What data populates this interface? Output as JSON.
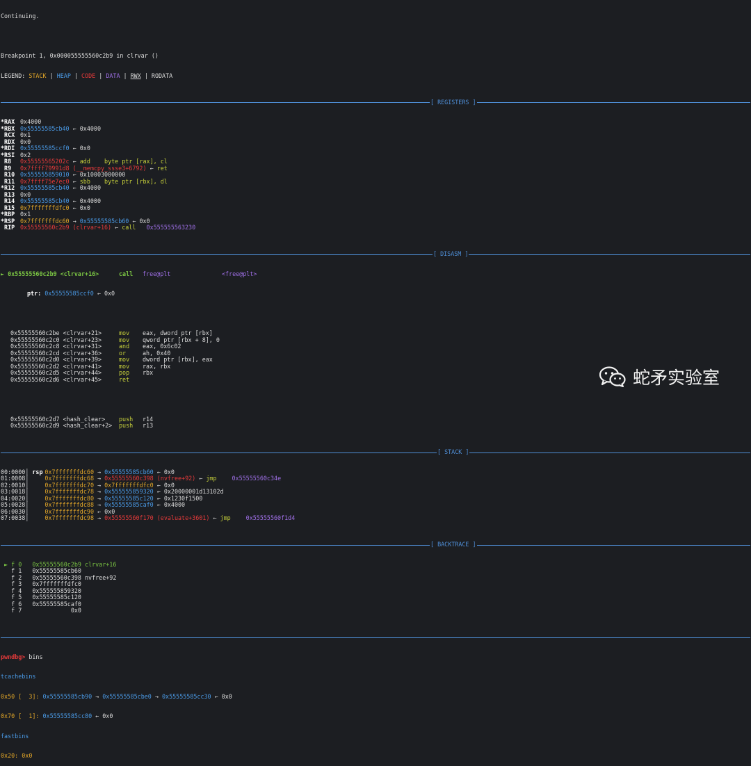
{
  "header": {
    "continuing": "Continuing.",
    "breakpoint": "Breakpoint 1, 0x000055555560c2b9 in clrvar ()",
    "legend_prefix": "LEGEND: ",
    "legend_stack": "STACK",
    "legend_heap": "HEAP",
    "legend_code": "CODE",
    "legend_data": "DATA",
    "legend_rwx": "RWX",
    "legend_rodata": "RODATA",
    "sep": " | "
  },
  "sections": {
    "registers": "[ REGISTERS ]",
    "disasm": "[ DISASM ]",
    "stack": "[ STACK ]",
    "backtrace": "[ BACKTRACE ]"
  },
  "registers": [
    {
      "name": "*RAX",
      "val": "0x4000"
    },
    {
      "name": "*RBX",
      "val": "0x55555585cb40",
      "arrow": " ← ",
      "ref": "0x4000"
    },
    {
      "name": " RCX",
      "val": "0x1"
    },
    {
      "name": " RDX",
      "val": "0x0"
    },
    {
      "name": "*RDI",
      "val": "0x55555585ccf0",
      "arrow": " ← ",
      "ref": "0x0"
    },
    {
      "name": "*RSI",
      "val": "0x2"
    },
    {
      "name": " R8",
      "val": "0x55555565202c",
      "arrow": " ← ",
      "ins": "add    byte ptr [rax], cl"
    },
    {
      "name": " R9",
      "val": "0x7ffff79991d8 (__memcpy_ssse3+6792)",
      "arrow": " ← ",
      "ins": "ret"
    },
    {
      "name": " R10",
      "val": "0x555555859010",
      "arrow": " ← ",
      "ref": "0x10003000000"
    },
    {
      "name": " R11",
      "val": "0x7ffff75e7ec0",
      "arrow": " ← ",
      "ins": "sbb    byte ptr [rbx], dl"
    },
    {
      "name": "*R12",
      "val": "0x55555585cb40",
      "arrow": " ← ",
      "ref": "0x4000"
    },
    {
      "name": " R13",
      "val": "0x0"
    },
    {
      "name": " R14",
      "val": "0x55555585cb40",
      "arrow": " ← ",
      "ref": "0x4000"
    },
    {
      "name": " R15",
      "val": "0x7fffffffdfc0",
      "arrow": " ← ",
      "ref": "0x0"
    },
    {
      "name": "*RBP",
      "val": "0x1"
    },
    {
      "name": "*RSP",
      "val": "0x7fffffffdc60",
      "arrow": " → ",
      "val2": "0x55555585cb60",
      "arrow2": " ← ",
      "ref": "0x0"
    },
    {
      "name": " RIP",
      "val": "0x55555560c2b9 (clrvar+16)",
      "arrow": " ← ",
      "ins": "call   ",
      "ins2": "0x555555563230"
    }
  ],
  "disasm": {
    "current_marker": "►",
    "current_addr": "0x55555560c2b9 <clrvar+16>",
    "current_mn": "call",
    "current_op": "free@plt",
    "current_target": "<free@plt>",
    "ptr_label": "ptr: ",
    "ptr_val": "0x55555585ccf0",
    "ptr_ref": " ← 0x0",
    "lines": [
      {
        "addr": "0x55555560c2be <clrvar+21>",
        "mn": "mov",
        "op": "eax, dword ptr [rbx]"
      },
      {
        "addr": "0x55555560c2c0 <clrvar+23>",
        "mn": "mov",
        "op": "qword ptr [rbx + 8], 0"
      },
      {
        "addr": "0x55555560c2c8 <clrvar+31>",
        "mn": "and",
        "op": "eax, 0x6c02"
      },
      {
        "addr": "0x55555560c2cd <clrvar+36>",
        "mn": "or",
        "op": "ah, 0x40"
      },
      {
        "addr": "0x55555560c2d0 <clrvar+39>",
        "mn": "mov",
        "op": "dword ptr [rbx], eax"
      },
      {
        "addr": "0x55555560c2d2 <clrvar+41>",
        "mn": "mov",
        "op": "rax, rbx"
      },
      {
        "addr": "0x55555560c2d5 <clrvar+44>",
        "mn": "pop",
        "op": "rbx"
      },
      {
        "addr": "0x55555560c2d6 <clrvar+45>",
        "mn": "ret",
        "op": ""
      }
    ],
    "lines2": [
      {
        "addr": "0x55555560c2d7 <hash_clear>",
        "mn": "push",
        "op": "r14"
      },
      {
        "addr": "0x55555560c2d9 <hash_clear+2>",
        "mn": "push",
        "op": "r13"
      }
    ]
  },
  "stack": [
    {
      "idx": "00:0000",
      "tag": "rsp",
      "a": "0x7fffffffdc60",
      "b": "0x55555585cb60",
      "bc": "bl",
      "rest": " ← 0x0"
    },
    {
      "idx": "01:0008",
      "tag": "",
      "a": "0x7fffffffdc68",
      "b": "0x55555560c398 (nvfree+92)",
      "bc": "rd",
      "rest": " ← ",
      "mn": "jmp",
      "tgt": "0x55555560c34e"
    },
    {
      "idx": "02:0010",
      "tag": "",
      "a": "0x7fffffffdc70",
      "b": "0x7fffffffdfc0",
      "bc": "yl",
      "rest": " ← 0x0"
    },
    {
      "idx": "03:0018",
      "tag": "",
      "a": "0x7fffffffdc78",
      "b": "0x555555859320",
      "bc": "bl",
      "rest": " ← 0x20000001d13102d"
    },
    {
      "idx": "04:0020",
      "tag": "",
      "a": "0x7fffffffdc80",
      "b": "0x55555585c120",
      "bc": "bl",
      "rest": " ← 0x1230f1500"
    },
    {
      "idx": "05:0028",
      "tag": "",
      "a": "0x7fffffffdc88",
      "b": "0x55555585caf0",
      "bc": "bl",
      "rest": " ← 0x4000"
    },
    {
      "idx": "06:0030",
      "tag": "",
      "a": "0x7fffffffdc90",
      "b": "",
      "bc": "",
      "rest": " ← 0x0"
    },
    {
      "idx": "07:0038",
      "tag": "",
      "a": "0x7fffffffdc98",
      "b": "0x55555560f170 (evaluate+3601)",
      "bc": "rd",
      "rest": " ← ",
      "mn": "jmp",
      "tgt": "0x55555560f1d4"
    }
  ],
  "backtrace": [
    " ► f 0   0x55555560c2b9 clrvar+16",
    "   f 1   0x55555585cb60",
    "   f 2   0x55555560c398 nvfree+92",
    "   f 3   0x7fffffffdfc0",
    "   f 4   0x555555859320",
    "   f 5   0x55555585c120",
    "   f 6   0x55555585caf0",
    "   f 7              0x0"
  ],
  "prompt": {
    "name": "pwndbg>",
    "cmd": " bins"
  },
  "bins": {
    "tcache_title": "tcachebins",
    "tcache1_size": "0x50 [  3]:",
    "tcache1_a": "0x55555585cb90",
    "tcache1_b": "0x55555585cbe0",
    "tcache1_c": "0x55555585cc30",
    "tcache1_end": " ← 0x0",
    "tcache2_size": "0x70 [  1]:",
    "tcache2_a": "0x55555585cc80",
    "tcache2_end": " ← 0x0",
    "fast_title": "fastbins",
    "fast1": "0x20: 0x0"
  },
  "watermark": {
    "text": "蛇矛实验室",
    "icon": "wechat-icon"
  }
}
